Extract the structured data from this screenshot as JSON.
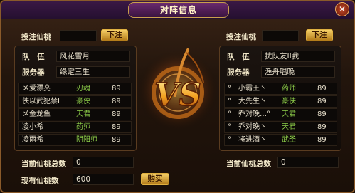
{
  "window": {
    "title": "对阵信息",
    "close_icon": "close-icon"
  },
  "left": {
    "bet_label": "投注仙桃",
    "bet_value": "",
    "bet_button": "下注",
    "team_label": "队　伍",
    "team_value": "风花雪月",
    "server_label": "服务器",
    "server_value": "缘定三生",
    "players": [
      {
        "name": "メ爱漂亮",
        "class": "刃魂",
        "level": "89"
      },
      {
        "name": "侠以武犯禁I",
        "class": "豪侠",
        "level": "89"
      },
      {
        "name": "メ金龙鱼",
        "class": "天君",
        "level": "89"
      },
      {
        "name": "凌小希",
        "class": "药师",
        "level": "89"
      },
      {
        "name": "凌雨希",
        "class": "阴阳师",
        "level": "89"
      }
    ],
    "total_label": "当前仙桃总数",
    "total_value": "0",
    "own_label": "现有仙桃数",
    "own_value": "600",
    "buy_button": "购买"
  },
  "right": {
    "bet_label": "投注仙桃",
    "bet_value": "",
    "bet_button": "下注",
    "team_label": "队　伍",
    "team_value": "扰队友II我",
    "server_label": "服务器",
    "server_value": "渔舟唱晚",
    "players": [
      {
        "name": "°　小霸王丶",
        "class": "药师",
        "level": "89"
      },
      {
        "name": "°　大先生丶",
        "class": "豪侠",
        "level": "89"
      },
      {
        "name": "°　乔对晚…°",
        "class": "天君",
        "level": "89"
      },
      {
        "name": "°　乔对晚丶",
        "class": "天君",
        "level": "89"
      },
      {
        "name": "°　将进酒丶",
        "class": "武圣",
        "level": "89"
      }
    ],
    "total_label": "当前仙桃总数",
    "total_value": "0"
  },
  "center": {
    "emblem_text": "VS"
  },
  "colors": {
    "class_text": "#8fd04a",
    "button": "#f6d068",
    "title_plate": "#6a2a6e"
  }
}
